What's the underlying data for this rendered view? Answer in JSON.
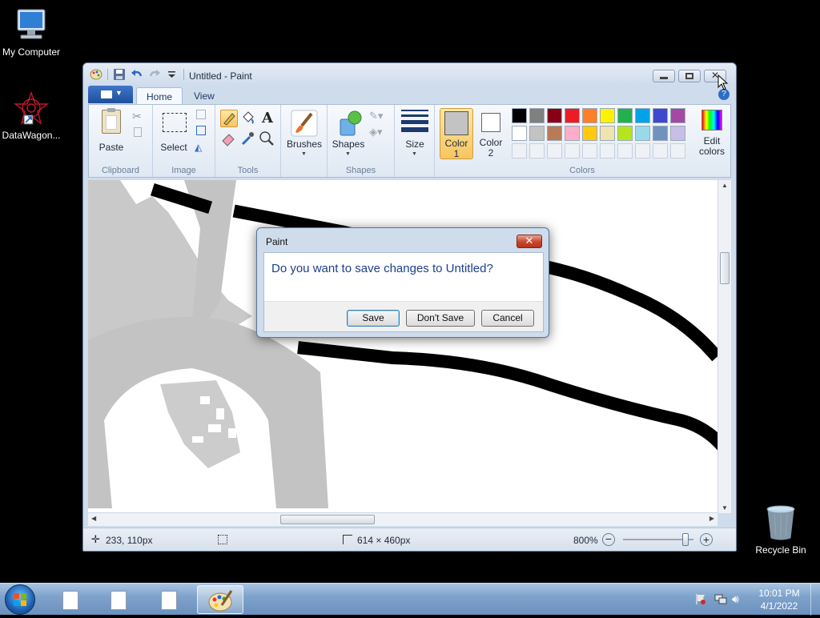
{
  "desktop": {
    "icons": [
      {
        "label": "My Computer"
      },
      {
        "label": "DataWagon..."
      },
      {
        "label": "Recycle Bin"
      }
    ]
  },
  "window": {
    "title": "Untitled - Paint",
    "tabs": [
      "Home",
      "View"
    ],
    "groups": {
      "clipboard": "Clipboard",
      "image": "Image",
      "tools": "Tools",
      "shapes": "Shapes",
      "colors": "Colors"
    },
    "buttons": {
      "paste": "Paste",
      "select": "Select",
      "brushes": "Brushes",
      "shapes": "Shapes",
      "size": "Size",
      "color1_a": "Color",
      "color1_b": "1",
      "color2_a": "Color",
      "color2_b": "2",
      "edit_colors_a": "Edit",
      "edit_colors_b": "colors"
    },
    "palette_row1": [
      "#000000",
      "#7f7f7f",
      "#880015",
      "#ed1c24",
      "#ff7f27",
      "#fff200",
      "#22b14c",
      "#00a2e8",
      "#3f48cc",
      "#a349a4"
    ],
    "palette_row2": [
      "#ffffff",
      "#c3c3c3",
      "#b97a57",
      "#ffaec9",
      "#ffc90e",
      "#efe4b0",
      "#b5e61d",
      "#99d9ea",
      "#7092be",
      "#c8bfe7"
    ],
    "color1": "#c3c3c3",
    "color2": "#ffffff",
    "status": {
      "cursor_pos": "233, 110px",
      "canvas_size": "614 × 460px",
      "zoom": "800%"
    }
  },
  "dialog": {
    "title": "Paint",
    "message": "Do you want to save changes to Untitled?",
    "save": "Save",
    "dont_save": "Don't Save",
    "cancel": "Cancel"
  },
  "taskbar": {
    "time": "10:01 PM",
    "date": "4/1/2022"
  }
}
